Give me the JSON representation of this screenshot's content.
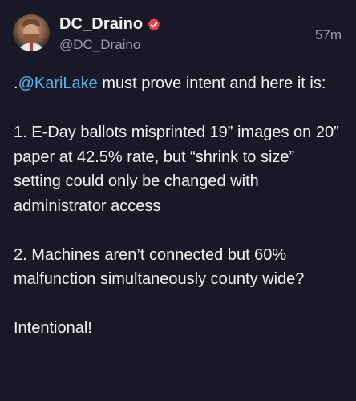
{
  "author": {
    "display_name": "DC_Draino",
    "handle": "@DC_Draino",
    "verified_badge_color": "#e8404d"
  },
  "timestamp": "57m",
  "tweet": {
    "mention_prefix": ".",
    "mention": "@KariLake",
    "intro_rest": " must prove intent and here it is:",
    "point1": "1. E-Day ballots misprinted 19” images on 20” paper at 42.5% rate, but “shrink to size” setting could only be changed with administrator access",
    "point2": "2. Machines aren’t connected but 60% malfunction simultaneously county wide?",
    "closing": "Intentional!"
  },
  "colors": {
    "background": "#191827",
    "text": "#f2f2f5",
    "muted": "#9d9cab",
    "link": "#5fb4ee"
  }
}
